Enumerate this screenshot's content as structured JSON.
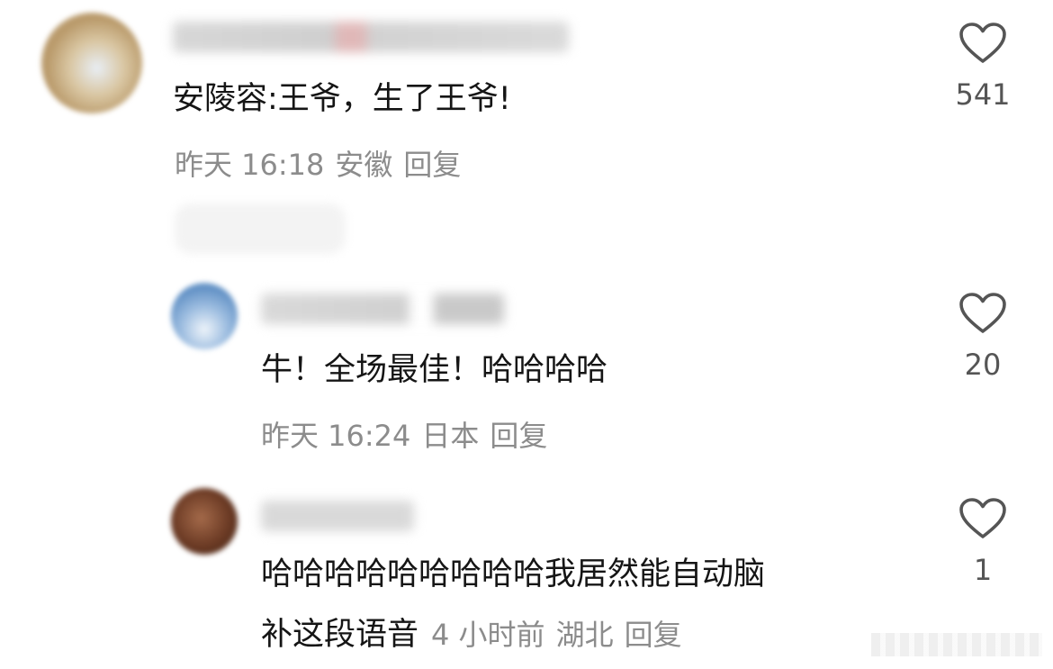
{
  "comments": [
    {
      "text": "安陵容:王爷，生了王爷!",
      "meta": {
        "time": "昨天 16:18",
        "location": "安徽",
        "reply": "回复"
      },
      "likes": "541"
    },
    {
      "text": "牛！全场最佳！哈哈哈哈",
      "meta": {
        "time": "昨天 16:24",
        "location": "日本",
        "reply": "回复"
      },
      "likes": "20"
    },
    {
      "text_line1": "哈哈哈哈哈哈哈哈哈我居然能自动脑",
      "text_line2": "补这段语音",
      "meta": {
        "time": "4 小时前",
        "location": "湖北",
        "reply": "回复"
      },
      "likes": "1"
    }
  ],
  "icons": {
    "like": "heart-outline-icon"
  },
  "colors": {
    "meta_text": "#8c8c8c",
    "body_text": "#151515",
    "like_count": "#555555"
  }
}
